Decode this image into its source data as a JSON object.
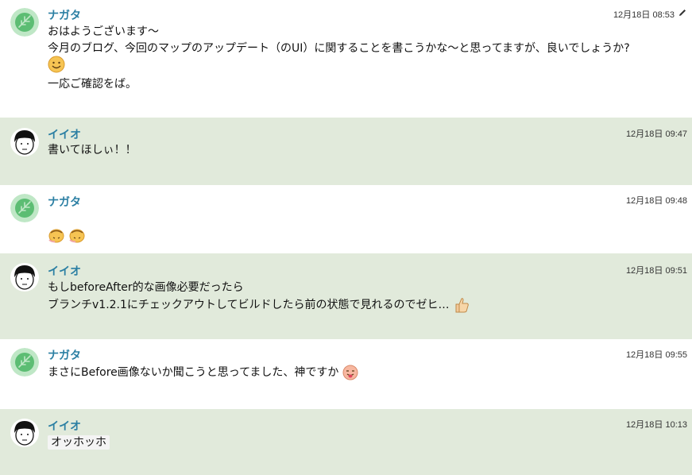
{
  "colors": {
    "name": "#2b7fa3",
    "alt_row_bg": "#e1eadb",
    "leaf_avatar_bg": "#bfe7c6",
    "leaf_avatar_fg": "#5cbd73"
  },
  "messages": [
    {
      "author": "ナガタ",
      "avatar": "leaf-avatar",
      "time": "12月18日 08:53",
      "edited": true,
      "lines": [
        "おはようございます〜",
        "今月のブログ、今回のマップのアップデート（のUI）に関することを書こうかな〜と思ってますが、良いでしょうか?",
        "一応ご確認をば。"
      ],
      "emoji": "smile-emoji"
    },
    {
      "author": "イイオ",
      "avatar": "face-avatar",
      "time": "12月18日 09:47",
      "lines": [
        "書いてほしぃ！！"
      ]
    },
    {
      "author": "ナガタ",
      "avatar": "leaf-avatar",
      "time": "12月18日 09:48",
      "emoji": "bow-emoji"
    },
    {
      "author": "イイオ",
      "avatar": "face-avatar",
      "time": "12月18日 09:51",
      "lines": [
        "もしbeforeAfter的な画像必要だったら",
        "ブランチv1.2.1にチェックアウトしてビルドしたら前の状態で見れるのでゼヒ…"
      ],
      "emoji": "thumbs-up-emoji"
    },
    {
      "author": "ナガタ",
      "avatar": "leaf-avatar",
      "time": "12月18日 09:55",
      "lines": [
        "まさにBefore画像ないか聞こうと思ってました、神ですか"
      ],
      "emoji": "tongue-emoji"
    },
    {
      "author": "イイオ",
      "avatar": "face-avatar",
      "time": "12月18日 10:13",
      "lines": [
        "オッホッホ"
      ]
    }
  ]
}
